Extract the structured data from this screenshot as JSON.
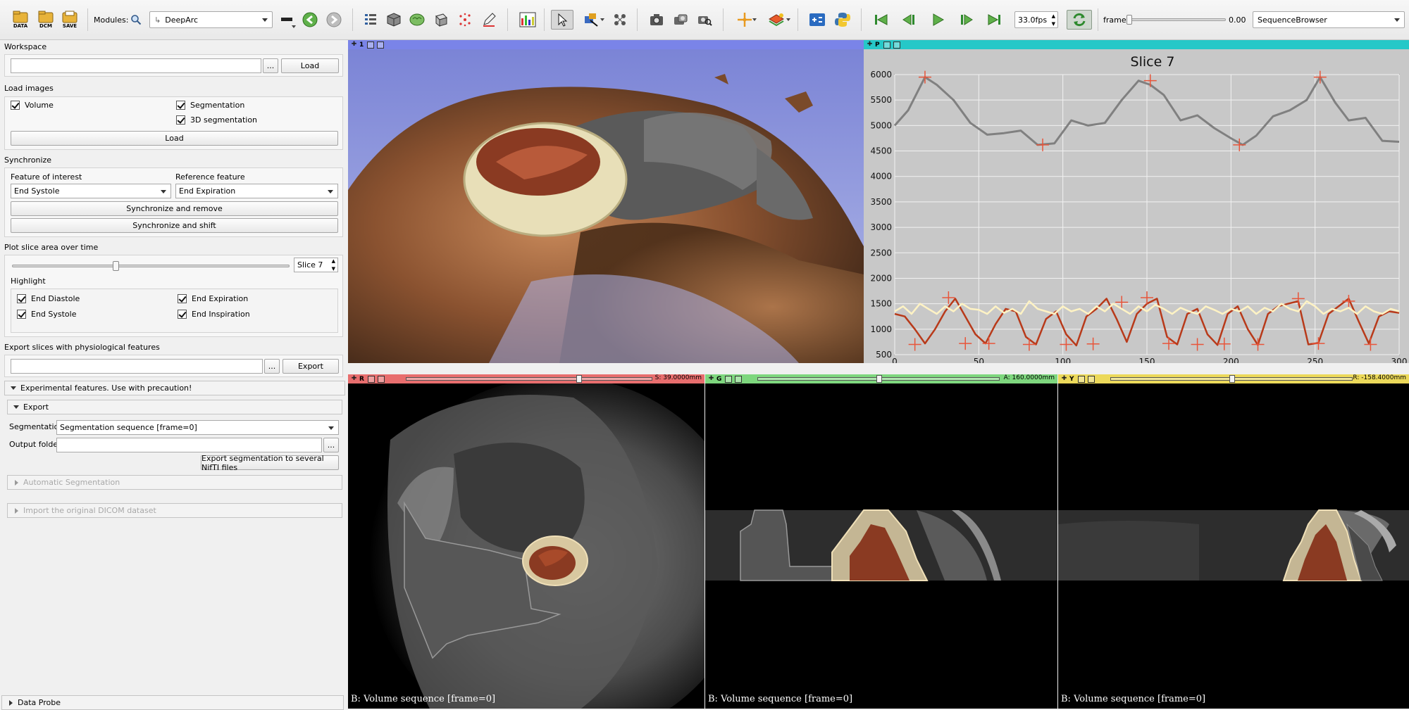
{
  "toolbar": {
    "data_button": "DATA",
    "dcm_button": "DCM",
    "save_button": "SAVE",
    "modules_label": "Modules:",
    "module_selected": "DeepArc",
    "fps_value": "33.0fps",
    "frame_label": "frame",
    "frame_value": "0.00",
    "sequence_browser": "SequenceBrowser"
  },
  "panel": {
    "workspace": {
      "title": "Workspace",
      "path_value": "",
      "browse_label": "...",
      "load_label": "Load"
    },
    "load_images": {
      "title": "Load images",
      "volume_label": "Volume",
      "segmentation_label": "Segmentation",
      "seg3d_label": "3D segmentation",
      "load_label": "Load"
    },
    "synchronize": {
      "title": "Synchronize",
      "feature_label": "Feature of interest",
      "feature_value": "End Systole",
      "reference_label": "Reference feature",
      "reference_value": "End Expiration",
      "sync_remove_label": "Synchronize and remove",
      "sync_shift_label": "Synchronize and shift"
    },
    "plot": {
      "title": "Plot slice area over time",
      "slice_value": "Slice 7",
      "slider_fraction": 0.37,
      "highlight_title": "Highlight",
      "end_diastole": "End Diastole",
      "end_systole": "End Systole",
      "end_expiration": "End Expiration",
      "end_inspiration": "End Inspiration"
    },
    "export_physio": {
      "title": "Export slices with physiological features",
      "path_value": "",
      "browse_label": "...",
      "export_label": "Export"
    },
    "experimental": {
      "title": "Experimental features. Use with precaution!",
      "export_title": "Export",
      "segmentation_label": "Segmentation",
      "segmentation_value": "Segmentation sequence [frame=0]",
      "output_label": "Output folder",
      "output_value": "",
      "browse_label": "...",
      "export_nifti_label": "Export segmentation to several NifTI files",
      "auto_seg_label": "Automatic Segmentation",
      "import_dicom_label": "Import the original DICOM dataset"
    },
    "data_probe_label": "Data Probe"
  },
  "views": {
    "view3d_label": "1",
    "plot_label": "P",
    "red_label": "R",
    "red_value": "S: 39.0000mm",
    "green_label": "G",
    "green_value": "A: 160.0000mm",
    "yellow_label": "Y",
    "yellow_value": "R: -158.4000mm",
    "red_caption": "B: Volume sequence [frame=0]",
    "green_caption": "B: Volume sequence [frame=0]",
    "yellow_caption": "B: Volume sequence [frame=0]",
    "red_slider_fraction": 0.7,
    "green_slider_fraction": 0.5,
    "yellow_slider_fraction": 0.5
  },
  "colors": {
    "red_bar": "#e86e6e",
    "green_bar": "#7ed77e",
    "yellow_bar": "#ecd95a",
    "cyan_bar": "#26c8c8",
    "blue_bar": "#7a84e8",
    "series_area": "#808080",
    "series_red": "#b83a1a",
    "series_cream": "#fff3c4"
  },
  "chart_data": {
    "type": "line",
    "title": "Slice 7",
    "xlim": [
      0,
      300
    ],
    "ylim": [
      500,
      6000
    ],
    "x_ticks": [
      "0",
      "50",
      "100",
      "150",
      "200",
      "250",
      "300"
    ],
    "y_ticks": [
      "500",
      "1000",
      "1500",
      "2000",
      "2500",
      "3000",
      "3500",
      "4000",
      "4500",
      "5000",
      "5500",
      "6000"
    ],
    "grid": true,
    "series": [
      {
        "color": "#808080",
        "x": [
          0,
          8,
          18,
          25,
          35,
          45,
          55,
          65,
          75,
          85,
          95,
          105,
          115,
          125,
          135,
          145,
          152,
          160,
          170,
          180,
          190,
          200,
          207,
          215,
          225,
          235,
          245,
          253,
          262,
          270,
          280,
          290,
          300
        ],
        "y": [
          5000,
          5300,
          5950,
          5800,
          5500,
          5050,
          4820,
          4850,
          4900,
          4620,
          4650,
          5100,
          5000,
          5050,
          5500,
          5880,
          5800,
          5600,
          5100,
          5200,
          4950,
          4750,
          4620,
          4800,
          5180,
          5300,
          5500,
          5950,
          5450,
          5100,
          5150,
          4700,
          4680
        ],
        "markers_x": [
          18,
          88,
          152,
          205,
          253
        ],
        "markers_y": [
          5950,
          4620,
          5880,
          4620,
          5950
        ]
      },
      {
        "color": "#b83a1a",
        "x": [
          0,
          6,
          12,
          18,
          24,
          30,
          36,
          42,
          48,
          54,
          60,
          66,
          72,
          78,
          84,
          90,
          96,
          102,
          108,
          114,
          120,
          126,
          132,
          138,
          144,
          150,
          156,
          162,
          168,
          174,
          180,
          186,
          192,
          198,
          204,
          210,
          216,
          222,
          228,
          234,
          240,
          246,
          252,
          258,
          264,
          270,
          276,
          282,
          288,
          294,
          300
        ],
        "y": [
          1300,
          1250,
          1000,
          720,
          1000,
          1350,
          1600,
          1250,
          900,
          720,
          1100,
          1400,
          1350,
          850,
          700,
          1200,
          1350,
          900,
          680,
          1250,
          1400,
          1600,
          1200,
          750,
          1300,
          1500,
          1600,
          850,
          700,
          1300,
          1400,
          900,
          690,
          1300,
          1450,
          1000,
          690,
          1300,
          1450,
          1500,
          1550,
          700,
          730,
          1300,
          1450,
          1600,
          1150,
          720,
          1250,
          1350,
          1320
        ],
        "markers_x": [
          12,
          32,
          42,
          56,
          80,
          102,
          118,
          135,
          150,
          163,
          180,
          196,
          216,
          240,
          252,
          270,
          283
        ],
        "markers_y": [
          700,
          1620,
          720,
          720,
          700,
          700,
          710,
          1530,
          1620,
          720,
          700,
          710,
          700,
          1600,
          720,
          1550,
          700
        ]
      },
      {
        "color": "#fff3c4",
        "x": [
          0,
          5,
          10,
          15,
          20,
          25,
          30,
          35,
          40,
          45,
          50,
          55,
          60,
          65,
          70,
          75,
          80,
          85,
          90,
          95,
          100,
          105,
          110,
          115,
          120,
          125,
          130,
          135,
          140,
          145,
          150,
          155,
          160,
          165,
          170,
          175,
          180,
          185,
          190,
          195,
          200,
          205,
          210,
          215,
          220,
          225,
          230,
          235,
          240,
          245,
          250,
          255,
          260,
          265,
          270,
          275,
          280,
          285,
          290,
          295,
          300
        ],
        "y": [
          1350,
          1450,
          1300,
          1500,
          1400,
          1300,
          1450,
          1350,
          1500,
          1400,
          1380,
          1300,
          1450,
          1320,
          1400,
          1300,
          1550,
          1400,
          1350,
          1300,
          1450,
          1350,
          1400,
          1300,
          1450,
          1350,
          1500,
          1400,
          1300,
          1450,
          1350,
          1480,
          1400,
          1300,
          1420,
          1350,
          1300,
          1450,
          1380,
          1300,
          1400,
          1350,
          1450,
          1300,
          1420,
          1350,
          1500,
          1400,
          1350,
          1550,
          1450,
          1300,
          1400,
          1350,
          1420,
          1300,
          1450,
          1350,
          1300,
          1400,
          1350
        ]
      }
    ]
  }
}
